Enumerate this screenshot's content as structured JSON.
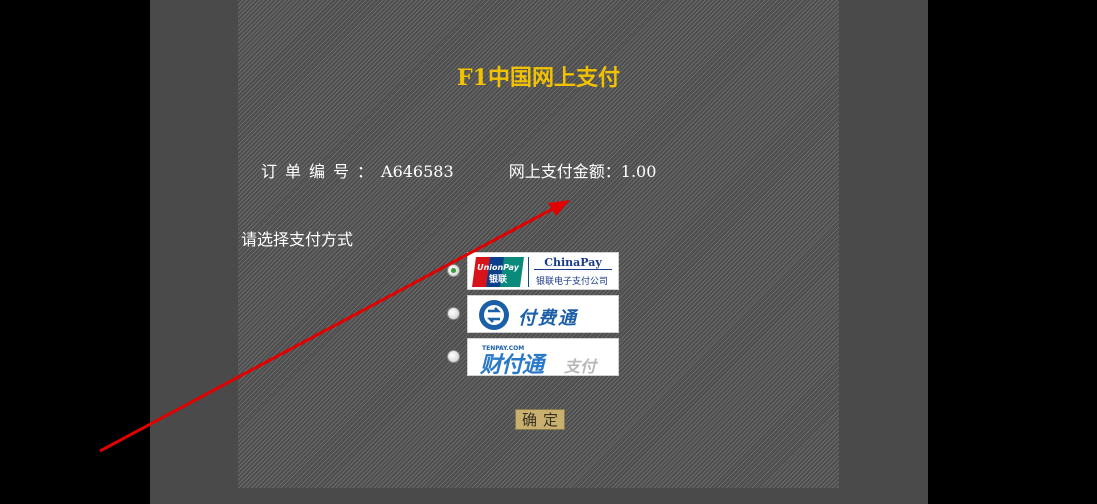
{
  "title": "F1中国网上支付",
  "order": {
    "number_label": "订单编号：",
    "number_value": "A646583",
    "amount_label": "网上支付金额：",
    "amount_value": "1.00"
  },
  "choose_label": "请选择支付方式",
  "payment_options": [
    {
      "name": "ChinaPay",
      "selected": true,
      "logo_mark": "UnionPay",
      "logo_mark_cn": "银联",
      "logo_sub": "银联电子支付公司"
    },
    {
      "name": "付费通",
      "selected": false
    },
    {
      "name": "财付通",
      "selected": false,
      "logo_small": "TENPAY.COM",
      "logo_sub": "支付"
    }
  ],
  "confirm_label": "确定",
  "colors": {
    "title": "#f2c200",
    "arrow": "#e00000",
    "confirm_bg": "#c8b070"
  }
}
